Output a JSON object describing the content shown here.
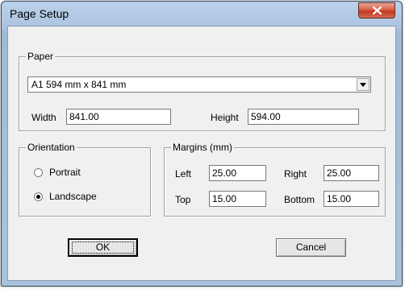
{
  "window": {
    "title": "Page Setup"
  },
  "paper": {
    "group_label": "Paper",
    "size_selected": "A1 594 mm x 841 mm",
    "width_label": "Width",
    "width_value": "841.00",
    "height_label": "Height",
    "height_value": "594.00"
  },
  "orientation": {
    "group_label": "Orientation",
    "portrait_label": "Portrait",
    "landscape_label": "Landscape",
    "selected": "Landscape"
  },
  "margins": {
    "group_label": "Margins (mm)",
    "left_label": "Left",
    "left_value": "25.00",
    "right_label": "Right",
    "right_value": "25.00",
    "top_label": "Top",
    "top_value": "15.00",
    "bottom_label": "Bottom",
    "bottom_value": "15.00"
  },
  "buttons": {
    "ok_label": "OK",
    "cancel_label": "Cancel"
  },
  "colors": {
    "title_bar": "#b9d1ea",
    "close_button": "#c7452c",
    "dialog_face": "#f0f0f0"
  },
  "icons": {
    "close": "close-icon",
    "dropdown": "chevron-down-icon"
  }
}
